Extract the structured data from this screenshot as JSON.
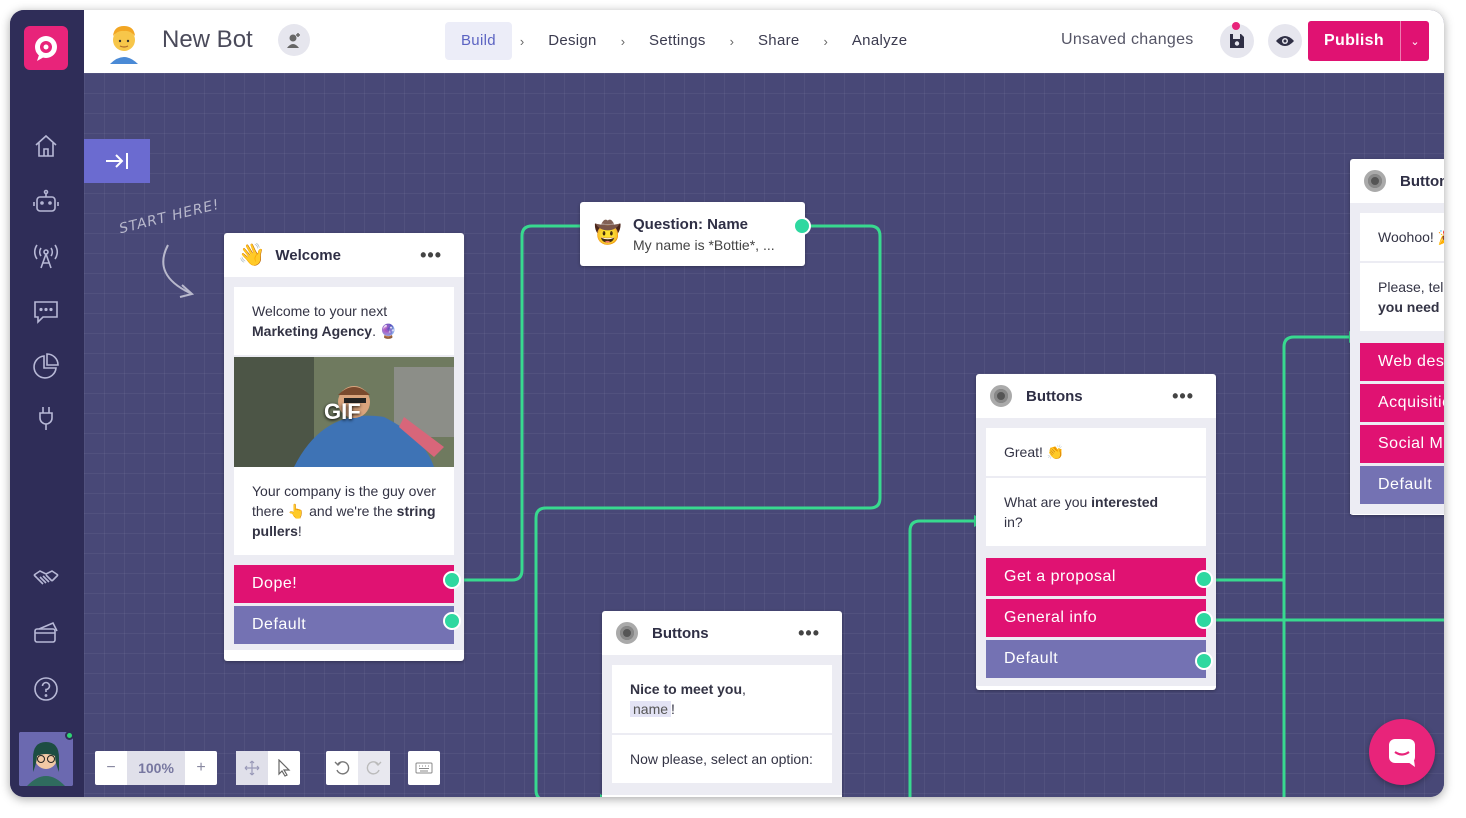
{
  "app": {
    "bot_name": "New Bot",
    "unsaved_label": "Unsaved changes",
    "publish_label": "Publish"
  },
  "steps": [
    "Build",
    "Design",
    "Settings",
    "Share",
    "Analyze"
  ],
  "active_step": "Build",
  "canvas": {
    "start_hint": "START HERE!",
    "zoom": "100%"
  },
  "welcome_card": {
    "title": "Welcome",
    "msg1_a": "Welcome to your next",
    "msg1_b": "Marketing Agency",
    "msg1_c": ".",
    "gif_label": "GIF",
    "msg2_a": "Your company is the guy over there",
    "msg2_b": "and we're the",
    "msg2_c": "string pullers",
    "msg2_d": "!",
    "buttons": [
      "Dope!",
      "Default"
    ]
  },
  "question_card": {
    "title": "Question: Name",
    "subtitle": "My name is *Bottie*, ..."
  },
  "buttons_card_mid": {
    "title": "Buttons",
    "msg1_a": "Nice to meet you",
    "msg1_b": ",",
    "name_tag": "name",
    "msg1_c": "!",
    "msg2": "Now please, select an option:"
  },
  "buttons_card_right": {
    "title": "Buttons",
    "msg1": "Great!",
    "msg2_a": "What are you",
    "msg2_b": "interested",
    "msg2_c": "in?",
    "buttons": [
      "Get a proposal",
      "General info",
      "Default"
    ]
  },
  "buttons_card_far": {
    "title": "Button",
    "msg1": "Woohoo!",
    "msg2_a": "Please, tell",
    "msg2_b": "you need h",
    "buttons": [
      "Web desi",
      "Acquisitio",
      "Social Me",
      "Default"
    ]
  },
  "colors": {
    "accent_pink": "#e01272",
    "default_purple": "#7472b3",
    "connector_green": "#2ed8a0",
    "canvas_bg": "#484877",
    "sidebar_bg": "#2f2d58"
  },
  "icons": {
    "sidebar": [
      "home-icon",
      "bot-icon",
      "broadcast-icon",
      "chat-icon",
      "analytics-icon",
      "plug-icon",
      "handshake-icon",
      "billing-icon",
      "help-icon"
    ]
  }
}
